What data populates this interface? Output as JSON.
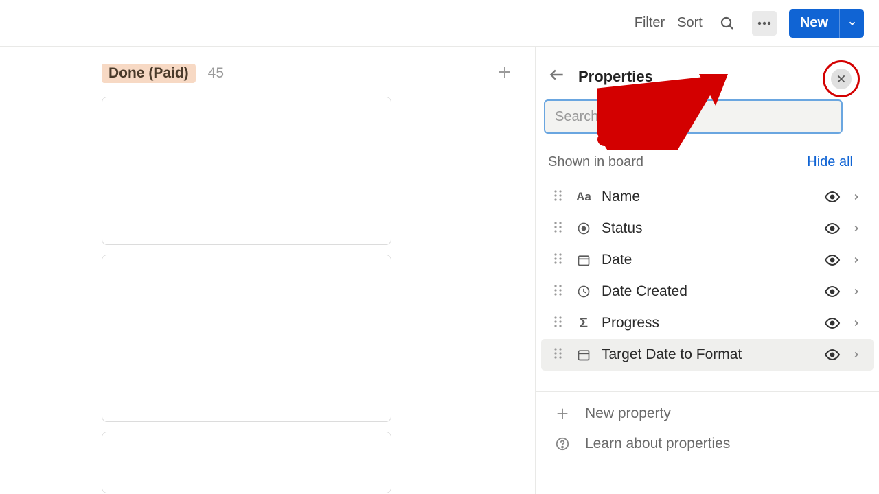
{
  "toolbar": {
    "filter": "Filter",
    "sort": "Sort",
    "new": "New"
  },
  "board": {
    "column_tag": "Done (Paid)",
    "column_count": "45"
  },
  "panel": {
    "title": "Properties",
    "search_placeholder": "Search for a property...",
    "section_label": "Shown in board",
    "hide_all": "Hide all",
    "properties": [
      {
        "label": "Name"
      },
      {
        "label": "Status"
      },
      {
        "label": "Date"
      },
      {
        "label": "Date Created"
      },
      {
        "label": "Progress"
      },
      {
        "label": "Target Date to Format"
      }
    ],
    "new_property": "New property",
    "learn": "Learn about properties"
  }
}
